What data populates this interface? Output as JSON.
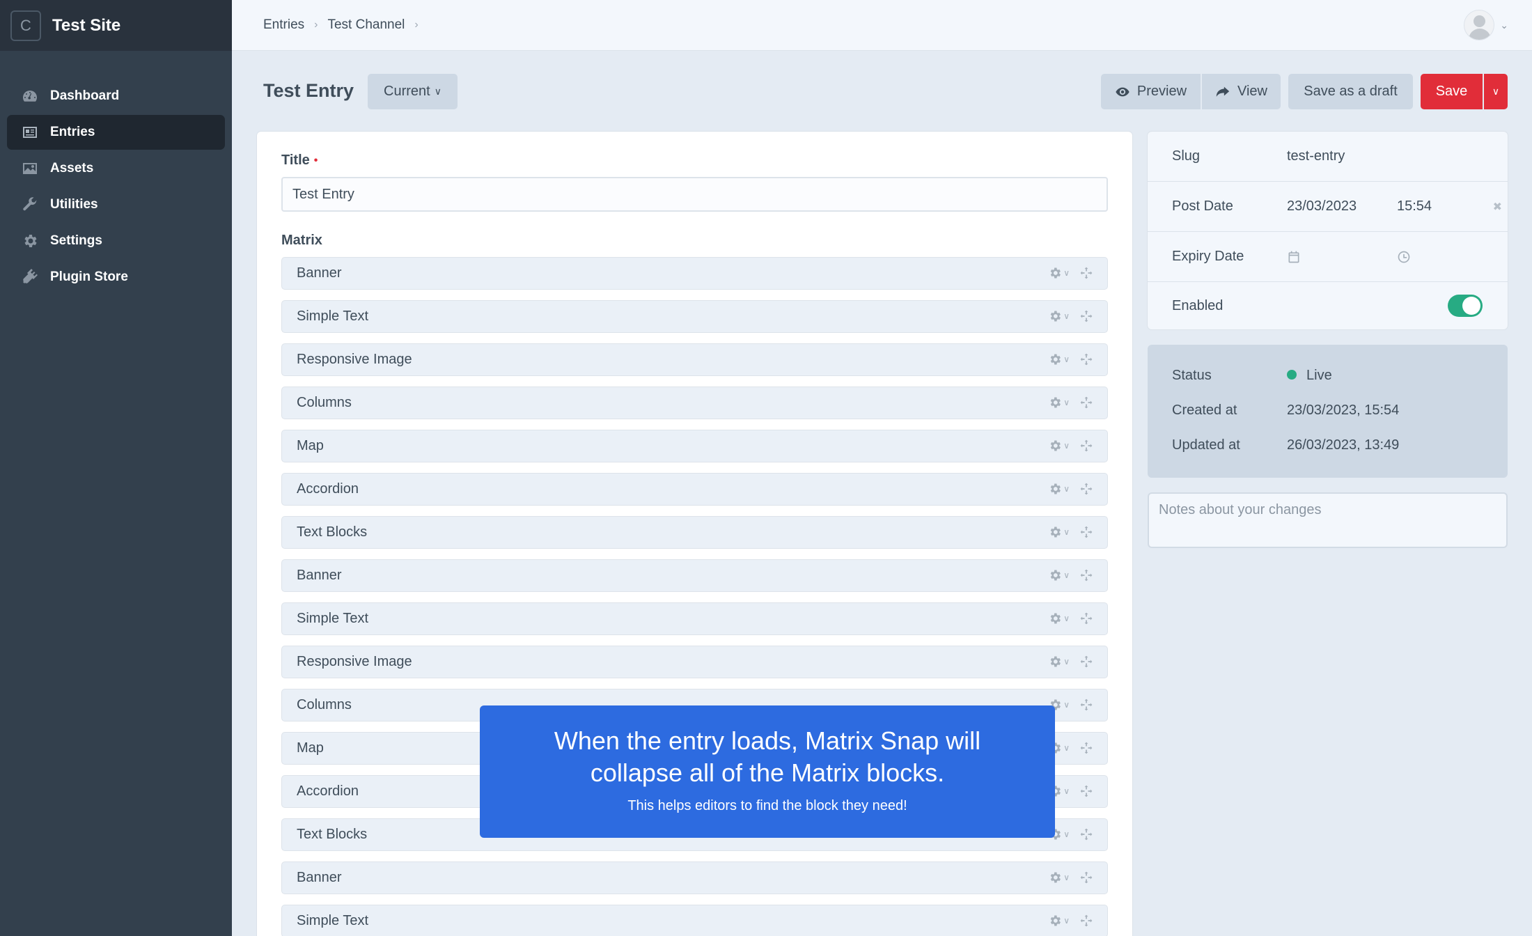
{
  "site": {
    "logo_letter": "C",
    "name": "Test Site"
  },
  "nav": {
    "items": [
      {
        "label": "Dashboard",
        "icon": "dashboard-icon"
      },
      {
        "label": "Entries",
        "icon": "entries-icon",
        "active": true
      },
      {
        "label": "Assets",
        "icon": "assets-icon"
      },
      {
        "label": "Utilities",
        "icon": "wrench-icon"
      },
      {
        "label": "Settings",
        "icon": "gear-icon"
      },
      {
        "label": "Plugin Store",
        "icon": "plug-icon"
      }
    ]
  },
  "breadcrumb": [
    "Entries",
    "Test Channel"
  ],
  "header": {
    "title": "Test Entry",
    "revision_label": "Current",
    "preview_label": "Preview",
    "view_label": "View",
    "draft_label": "Save as a draft",
    "save_label": "Save"
  },
  "fields": {
    "title_label": "Title",
    "title_value": "Test Entry",
    "matrix_label": "Matrix",
    "matrix_blocks": [
      "Banner",
      "Simple Text",
      "Responsive Image",
      "Columns",
      "Map",
      "Accordion",
      "Text Blocks",
      "Banner",
      "Simple Text",
      "Responsive Image",
      "Columns",
      "Map",
      "Accordion",
      "Text Blocks",
      "Banner",
      "Simple Text"
    ]
  },
  "meta": {
    "slug_label": "Slug",
    "slug_value": "test-entry",
    "post_date_label": "Post Date",
    "post_date_value": "23/03/2023",
    "post_time_value": "15:54",
    "expiry_date_label": "Expiry Date",
    "enabled_label": "Enabled",
    "enabled": true
  },
  "status": {
    "status_label": "Status",
    "status_value": "Live",
    "status_color": "#27ab83",
    "created_label": "Created at",
    "created_value": "23/03/2023, 15:54",
    "updated_label": "Updated at",
    "updated_value": "26/03/2023, 13:49"
  },
  "notes_placeholder": "Notes about your changes",
  "callout": {
    "heading": "When the entry loads, Matrix Snap will collapse all of the Matrix blocks.",
    "sub": "This helps editors to find the block they need!"
  },
  "colors": {
    "sidebar": "#33404d",
    "accent_red": "#e12d39",
    "callout_blue": "#2d6be0",
    "live_green": "#27ab83"
  }
}
